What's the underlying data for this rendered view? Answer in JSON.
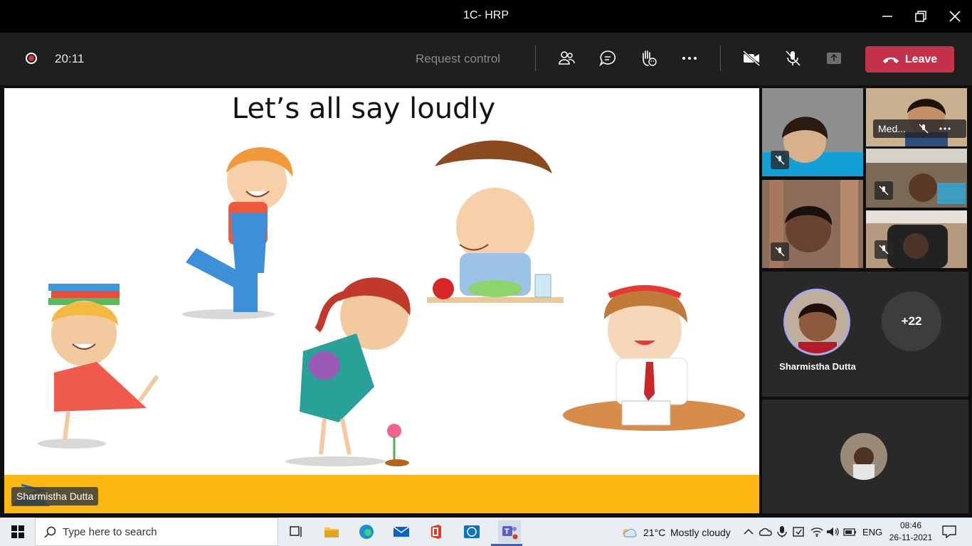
{
  "window": {
    "title": "1C- HRP"
  },
  "toolbar": {
    "timer": "20:11",
    "request_control": "Request control",
    "leave_label": "Leave"
  },
  "slide": {
    "title": "Let’s all say loudly",
    "presenter": "Sharmistha Dutta"
  },
  "participants": {
    "tile_name": "Med...",
    "main_name": "Sharmistha Dutta",
    "overflow_count": "+22"
  },
  "taskbar": {
    "search_placeholder": "Type here to search",
    "weather_temp": "21°C",
    "weather_text": "Mostly cloudy",
    "language": "ENG",
    "time": "08:46",
    "date": "26-11-2021"
  },
  "colors": {
    "leave": "#c4314b",
    "accent": "#6264a7",
    "band": "#fdb913"
  }
}
